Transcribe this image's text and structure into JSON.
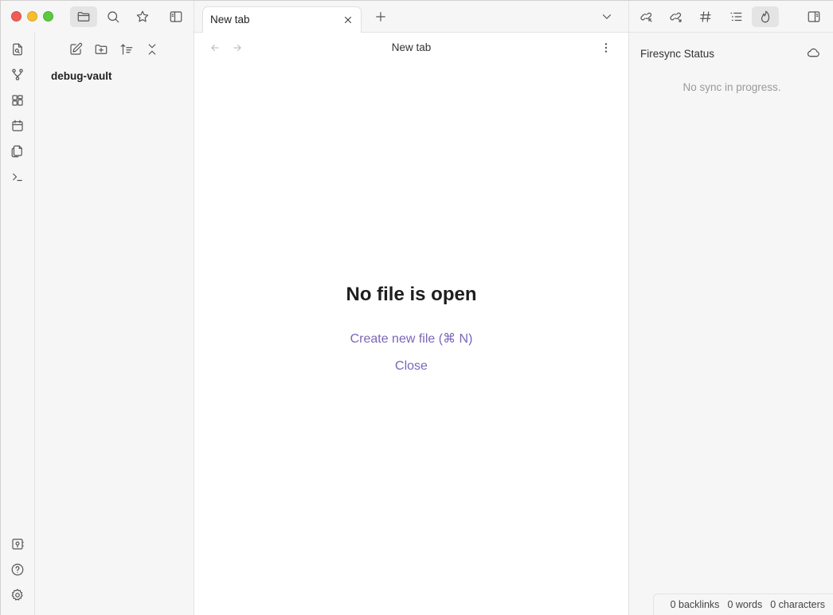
{
  "tabs": [
    {
      "title": "New tab",
      "active": true
    }
  ],
  "main": {
    "view_title": "New tab",
    "empty_title": "No file is open",
    "create_file_label": "Create new file (⌘ N)",
    "close_label": "Close"
  },
  "explorer": {
    "vault_name": "debug-vault"
  },
  "right_sidebar": {
    "title": "Firesync Status",
    "message": "No sync in progress."
  },
  "status_bar": {
    "backlinks": "0 backlinks",
    "words": "0 words",
    "characters": "0 characters"
  },
  "colors": {
    "accent": "#7a66b8",
    "traffic_close": "#ee5e57",
    "traffic_minimize": "#f5bd30",
    "traffic_maximize": "#5ec840"
  },
  "icons": {
    "top_left": [
      "folder-icon",
      "search-icon",
      "star-icon",
      "sidebar-toggle-icon"
    ],
    "top_right": [
      "backlink-icon",
      "outgoing-link-icon",
      "hashtag-icon",
      "outline-icon",
      "flame-icon",
      "right-sidebar-toggle-icon"
    ],
    "ribbon": [
      "file-search-icon",
      "graph-icon",
      "canvas-icon",
      "calendar-icon",
      "copy-icon",
      "terminal-icon",
      "vault-icon",
      "help-icon",
      "gear-icon"
    ],
    "explorer": [
      "new-note-icon",
      "new-folder-icon",
      "sort-icon",
      "collapse-icon"
    ]
  }
}
